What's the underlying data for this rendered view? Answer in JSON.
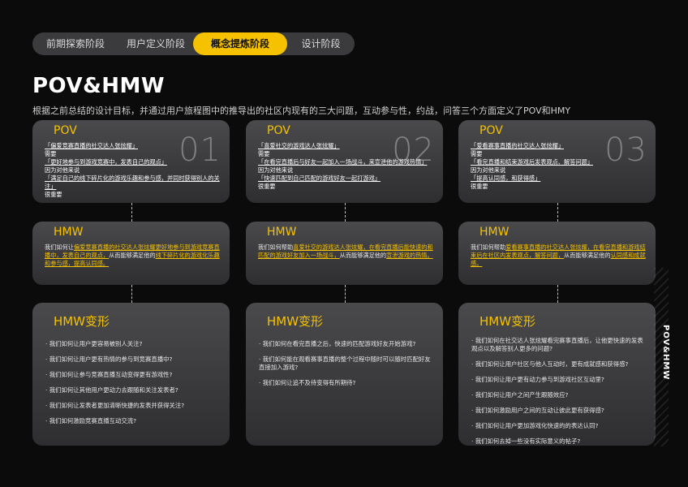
{
  "nav": {
    "tabs": [
      "前期探索阶段",
      "用户定义阶段",
      "概念提炼阶段",
      "设计阶段"
    ],
    "active_index": 2
  },
  "page": {
    "title": "POV&HMW",
    "subtitle": "根据之前总结的设计目标，并通过用户旅程图中的推导出的社区内现有的三大问题，互动参与性，约战，问答三个方面定义了POV和HMY",
    "side_label": "POV&HMW"
  },
  "columns": [
    {
      "number": "01",
      "pov_title": "POV",
      "pov_lines": [
        {
          "text": "「偏爱竞赛直播的社交达人张炫耀」",
          "u": true
        },
        {
          "text": "需要",
          "u": false
        },
        {
          "text": "「更好地参与到游戏竞赛中，发表自己的观点」",
          "u": true
        },
        {
          "text": "因为对他来说",
          "u": false
        },
        {
          "text": "「满足自己的线下碎片化的游戏乐趣和参与感，并同时获得别人的关注」",
          "u": true
        },
        {
          "text": "很重要",
          "u": false
        }
      ],
      "hmw_title": "HMW",
      "hmw_parts": [
        {
          "text": "我们如何让",
          "hl": false
        },
        {
          "text": "偏爱竞赛直播的社交达人张炫耀更好地参与到游戏竞赛直播中，发表自己的观点，",
          "hl": true
        },
        {
          "text": "从而能够满足他的",
          "hl": false
        },
        {
          "text": "线下碎片化的游戏化乐趣和参与感，提高认同感。",
          "hl": true
        }
      ],
      "var_title": "HMW变形",
      "variants": [
        "· 我们如何让用户更容易被别人关注?",
        "· 我们如何让用户更有热情的参与到竞赛直播中?",
        "· 我们如何让参与竞赛直播互动变得更有游戏性?",
        "· 我们如何让其他用户更动力去跟随和关注发表者?",
        "· 我们如何让发表者更加清晰快捷的发表并获得关注?",
        "· 我们如何激励竞赛直播互动交流?"
      ]
    },
    {
      "number": "02",
      "pov_title": "POV",
      "pov_lines": [
        {
          "text": "「喜爱社交的游戏达人张炫耀」",
          "u": true
        },
        {
          "text": "需要",
          "u": false
        },
        {
          "text": "「在看完直播后与好友一起加入一场战斗，来宣泄他的游戏热情」",
          "u": true
        },
        {
          "text": "因为对他来说",
          "u": false
        },
        {
          "text": "「快速匹配到自己匹配的游戏好友一起打游戏」",
          "u": true
        },
        {
          "text": "很重要",
          "u": false
        }
      ],
      "hmw_title": "HMW",
      "hmw_parts": [
        {
          "text": "我们如何帮助",
          "hl": false
        },
        {
          "text": "喜爱社交的游戏达人张炫耀，在看完直播后能快速的和匹配的游戏好友加入一场战斗，",
          "hl": true
        },
        {
          "text": "从而能够满足他的",
          "hl": false
        },
        {
          "text": "宣泄游戏的热情。",
          "hl": true
        }
      ],
      "var_title": "HMW变形",
      "variants": [
        "· 我们如何在看完直播之后，快速的匹配游戏好友开始游戏?",
        "· 我们如何能在观看赛事直播的整个过程中随时可以随时匹配好友直接加入游戏?",
        "· 我们如何让追不及待变得有所期待?"
      ]
    },
    {
      "number": "03",
      "pov_title": "POV",
      "pov_lines": [
        {
          "text": "「爱看赛事直播的社交达人张炫耀」",
          "u": true
        },
        {
          "text": "需要",
          "u": false
        },
        {
          "text": "「看完直播和结束游戏后发表观点、解答问题」",
          "u": true
        },
        {
          "text": "因为对他来说",
          "u": false
        },
        {
          "text": "「提高认同感，和获得感」",
          "u": true
        },
        {
          "text": "很重要",
          "u": false
        }
      ],
      "hmw_title": "HMW",
      "hmw_parts": [
        {
          "text": "我们如何帮助",
          "hl": false
        },
        {
          "text": "爱看赛事直播的社交达人张炫耀，在看完直播和游戏结束后在社区内发表观点，解答问题，",
          "hl": true
        },
        {
          "text": "从而能够满足他的",
          "hl": false
        },
        {
          "text": "认同感和成就感。",
          "hl": true
        }
      ],
      "var_title": "HMW变形",
      "variants": [
        "· 我们如何在社交达人张炫耀看完赛事直播后，让他更快速的发表观点以及解答别人更多的问题?",
        "· 我们如何让用户社区与他人互动时，更有成就感和获得感?",
        "· 我们如何让用户更有动力参与到游戏社区互动里?",
        "· 我们如何让用户之间产生跟随效应?",
        "· 我们如何激励用户之间的互动让彼此更有获得感?",
        "· 我们如何让用户更加游戏化快速的的表达认同?",
        "· 我们如何去掉一些没有实际意义的帖子?"
      ]
    }
  ],
  "colors": {
    "accent": "#f6c200",
    "background": "#0b0b0c",
    "card_top": "#4a4a4d",
    "card_bottom": "#2e2e31"
  }
}
